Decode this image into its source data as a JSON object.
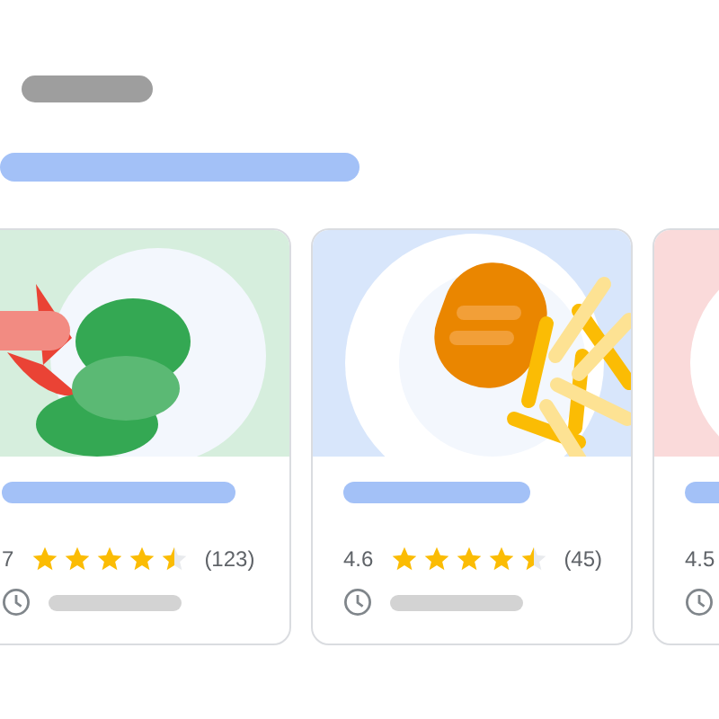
{
  "cards": [
    {
      "kind": "salad",
      "color": "#d6eedd",
      "rating": "7",
      "stars": 4.5,
      "count": "(123)"
    },
    {
      "kind": "chicken-fries",
      "color": "#d8e6fb",
      "rating": "4.6",
      "stars": 4.5,
      "count": "(45)"
    },
    {
      "kind": "plate",
      "color": "#fadada",
      "rating": "4.5"
    }
  ]
}
